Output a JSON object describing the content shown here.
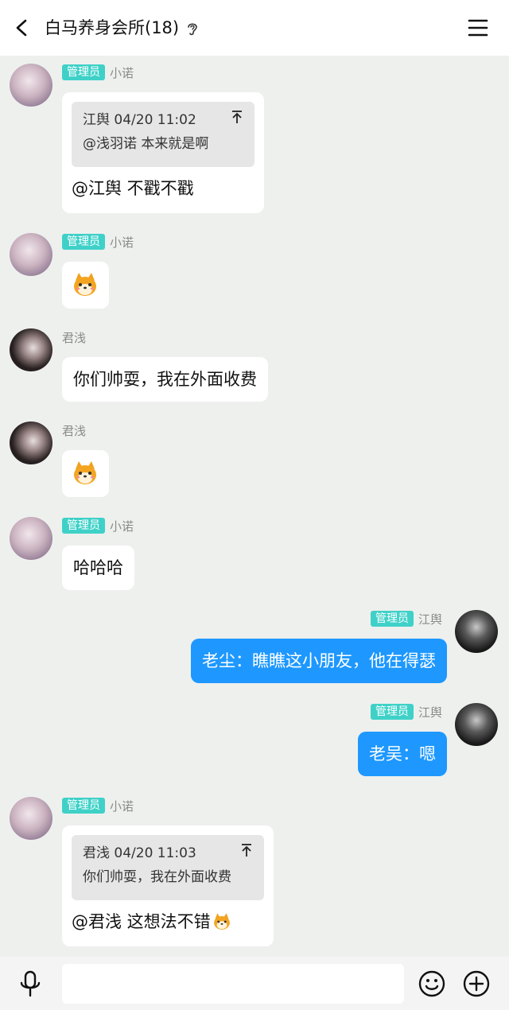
{
  "header": {
    "title": "白马养身会所(18)"
  },
  "messages": [
    {
      "sender": "小诺",
      "badge": "管理员",
      "quote": {
        "author_time": "江舆 04/20 11:02",
        "text": "@浅羽诺 本来就是啊"
      },
      "text": "@江舆 不戳不戳"
    },
    {
      "sender": "小诺",
      "badge": "管理员",
      "sticker": "shiba-sticker"
    },
    {
      "sender": "君浅",
      "text": "你们帅耍，我在外面收费"
    },
    {
      "sender": "君浅",
      "sticker": "shiba-sticker"
    },
    {
      "sender": "小诺",
      "badge": "管理员",
      "text": "哈哈哈"
    },
    {
      "sender": "江舆",
      "badge": "管理员",
      "text": "老尘：瞧瞧这小朋友，他在得瑟"
    },
    {
      "sender": "江舆",
      "badge": "管理员",
      "text": "老吴：嗯"
    },
    {
      "sender": "小诺",
      "badge": "管理员",
      "quote": {
        "author_time": "君浅 04/20 11:03",
        "text": "你们帅耍，我在外面收费"
      },
      "text": "@君浅 这想法不错"
    }
  ],
  "input_bar": {
    "value": ""
  },
  "icons": [
    "back-icon",
    "ear-icon",
    "menu-icon",
    "pin-icon",
    "shiba-sticker",
    "mic-icon",
    "emoji-icon",
    "plus-icon"
  ],
  "colors": {
    "badge": "#3fd1c8",
    "self_bubble": "#1e98ff",
    "background": "#eef0ee"
  }
}
